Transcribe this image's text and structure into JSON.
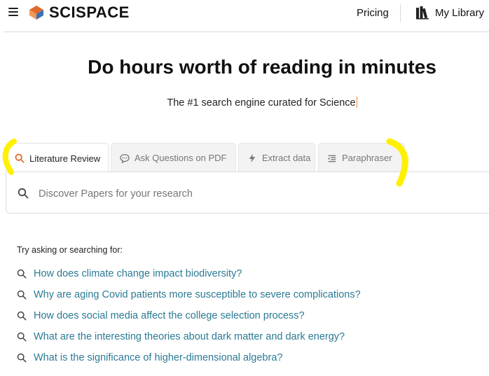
{
  "header": {
    "logo_text": "SCISPACE",
    "pricing_label": "Pricing",
    "library_label": "My Library",
    "icons": {
      "menu": "hamburger-menu-icon",
      "logo": "scispace-logo-icon",
      "library": "books-icon"
    }
  },
  "hero": {
    "title": "Do hours worth of reading in minutes",
    "subtitle": "The #1 search engine curated for Science"
  },
  "tabs": [
    {
      "label": "Literature Review",
      "icon": "search-icon",
      "active": true
    },
    {
      "label": "Ask Questions on PDF",
      "icon": "chat-bubble-icon",
      "active": false
    },
    {
      "label": "Extract data",
      "icon": "lightning-icon",
      "active": false
    },
    {
      "label": "Paraphraser",
      "icon": "text-align-icon",
      "active": false
    }
  ],
  "search": {
    "value": "",
    "placeholder": "Discover Papers for your research",
    "icon": "search-icon"
  },
  "suggestions": {
    "label": "Try asking or searching for:",
    "items": [
      "How does climate change impact biodiversity?",
      "Why are aging Covid patients more susceptible to severe complications?",
      "How does social media affect the college selection process?",
      "What are the interesting theories about dark matter and dark energy?",
      "What is the significance of higher-dimensional algebra?"
    ]
  },
  "colors": {
    "accent_orange": "#e0692b",
    "logo_blue": "#3b6fb6",
    "link_teal": "#2b7a94",
    "highlight_yellow": "#ffef00",
    "text_dark": "#111111",
    "border": "#dcdcdc"
  }
}
